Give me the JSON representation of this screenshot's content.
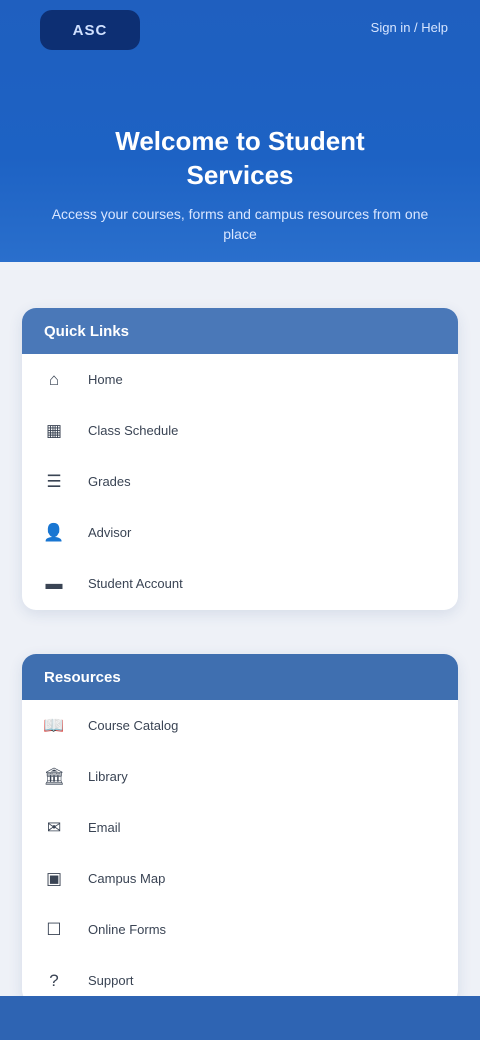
{
  "header": {
    "logo_text": "ASC",
    "top_link": "Sign in / Help",
    "title": "Welcome to Student Services",
    "subtitle": "Access your courses, forms and campus resources from one place"
  },
  "sections": [
    {
      "title": "Quick Links",
      "items": [
        {
          "icon": "home-icon",
          "glyph": "⌂",
          "label": "Home"
        },
        {
          "icon": "calendar-icon",
          "glyph": "▦",
          "label": "Class Schedule"
        },
        {
          "icon": "grades-icon",
          "glyph": "☰",
          "label": "Grades"
        },
        {
          "icon": "person-icon",
          "glyph": "👤",
          "label": "Advisor"
        },
        {
          "icon": "card-icon",
          "glyph": "▬",
          "label": "Student Account"
        }
      ]
    },
    {
      "title": "Resources",
      "items": [
        {
          "icon": "book-icon",
          "glyph": "📖",
          "label": "Course Catalog"
        },
        {
          "icon": "library-icon",
          "glyph": "🏛",
          "label": "Library"
        },
        {
          "icon": "mail-icon",
          "glyph": "✉",
          "label": "Email"
        },
        {
          "icon": "map-icon",
          "glyph": "▣",
          "label": "Campus Map"
        },
        {
          "icon": "forms-icon",
          "glyph": "☐",
          "label": "Online Forms"
        },
        {
          "icon": "support-icon",
          "glyph": "?",
          "label": "Support"
        }
      ]
    }
  ]
}
